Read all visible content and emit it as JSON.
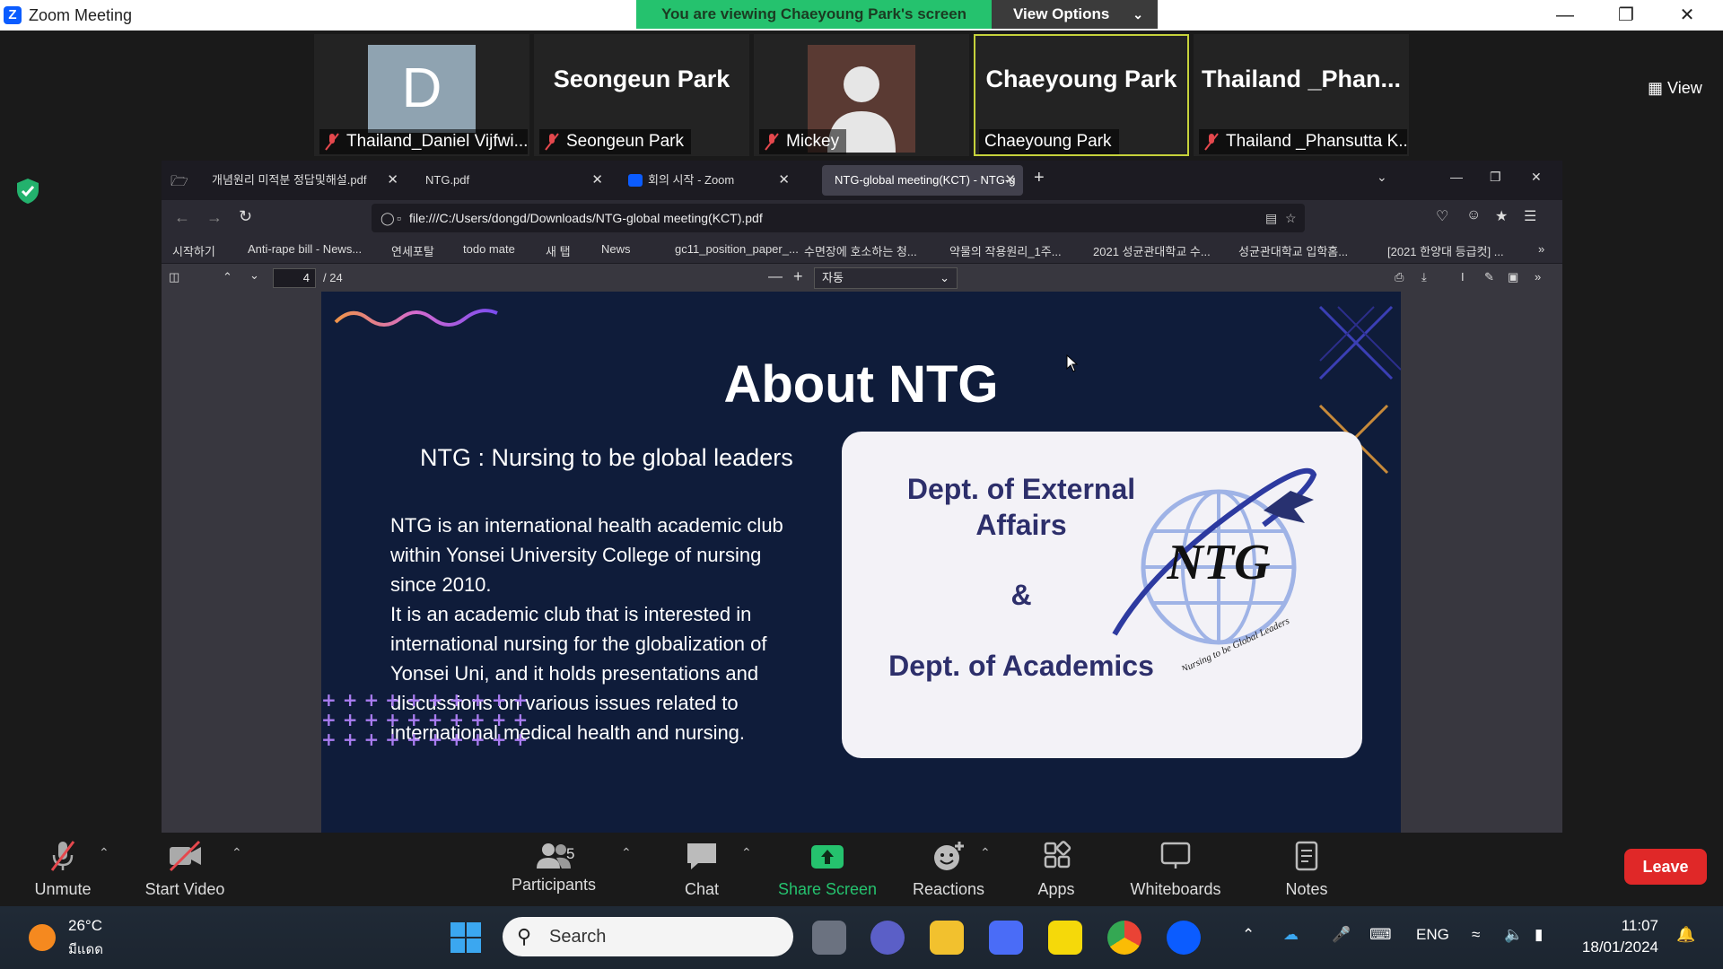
{
  "window": {
    "title": "Zoom Meeting",
    "share_banner": "You are viewing Chaeyoung Park's screen",
    "view_options": "View Options",
    "view_button": "View"
  },
  "participants": [
    {
      "big": "",
      "avatar_letter": "D",
      "name": "Thailand_Daniel Vijfwi..."
    },
    {
      "big": "Seongeun Park",
      "name": "Seongeun Park"
    },
    {
      "big": "",
      "name": "Mickey"
    },
    {
      "big": "Chaeyoung Park",
      "name": "Chaeyoung Park"
    },
    {
      "big": "Thailand _Phan...",
      "name": "Thailand _Phansutta K..."
    }
  ],
  "browser": {
    "tabs": [
      {
        "label": "개념원리 미적분 정답및해설.pdf"
      },
      {
        "label": "NTG.pdf"
      },
      {
        "label": "회의 시작 - Zoom"
      },
      {
        "label": "NTG-global meeting(KCT) - NTG-g"
      }
    ],
    "url": "file:///C:/Users/dongd/Downloads/NTG-global meeting(KCT).pdf",
    "bookmarks": [
      "시작하기",
      "Anti-rape bill - News...",
      "연세포탈",
      "todo mate",
      "새 탭",
      "News",
      "gc11_position_paper_...",
      "수면장에 호소하는 청...",
      "약물의 작용원리_1주...",
      "2021 성균관대학교 수...",
      "성균관대학교 입학홈...",
      "[2021 한양대 등급컷] ..."
    ],
    "pdf": {
      "page": "4",
      "total": "/ 24",
      "zoom": "자동"
    }
  },
  "slide": {
    "title": "About NTG",
    "subtitle": "NTG : Nursing to be global leaders",
    "body": "NTG is an international health academic club within Yonsei University College of nursing since 2010.\nIt is an academic club that is interested in international nursing for the globalization of Yonsei Uni, and it holds presentations and discussions on various issues related to international medical health and nursing.",
    "card_dept1": "Dept. of External Affairs",
    "card_amp": "&",
    "card_dept2": "Dept. of Academics",
    "logo_text": "NTG",
    "logo_tagline": "Nursing to be Global Leaders"
  },
  "toolbar": {
    "unmute": "Unmute",
    "start_video": "Start Video",
    "participants": "Participants",
    "participants_count": "5",
    "chat": "Chat",
    "share_screen": "Share Screen",
    "reactions": "Reactions",
    "apps": "Apps",
    "whiteboards": "Whiteboards",
    "notes": "Notes",
    "leave": "Leave"
  },
  "taskbar": {
    "temp": "26°C",
    "condition": "มีแดด",
    "search": "Search",
    "lang": "ENG",
    "time": "11:07",
    "date": "18/01/2024"
  },
  "colors": {
    "banner": "#25c26e",
    "leave": "#e02828",
    "share": "#25c26e",
    "slide_bg": "#0f1c3a",
    "card_text": "#2d2f6b"
  }
}
